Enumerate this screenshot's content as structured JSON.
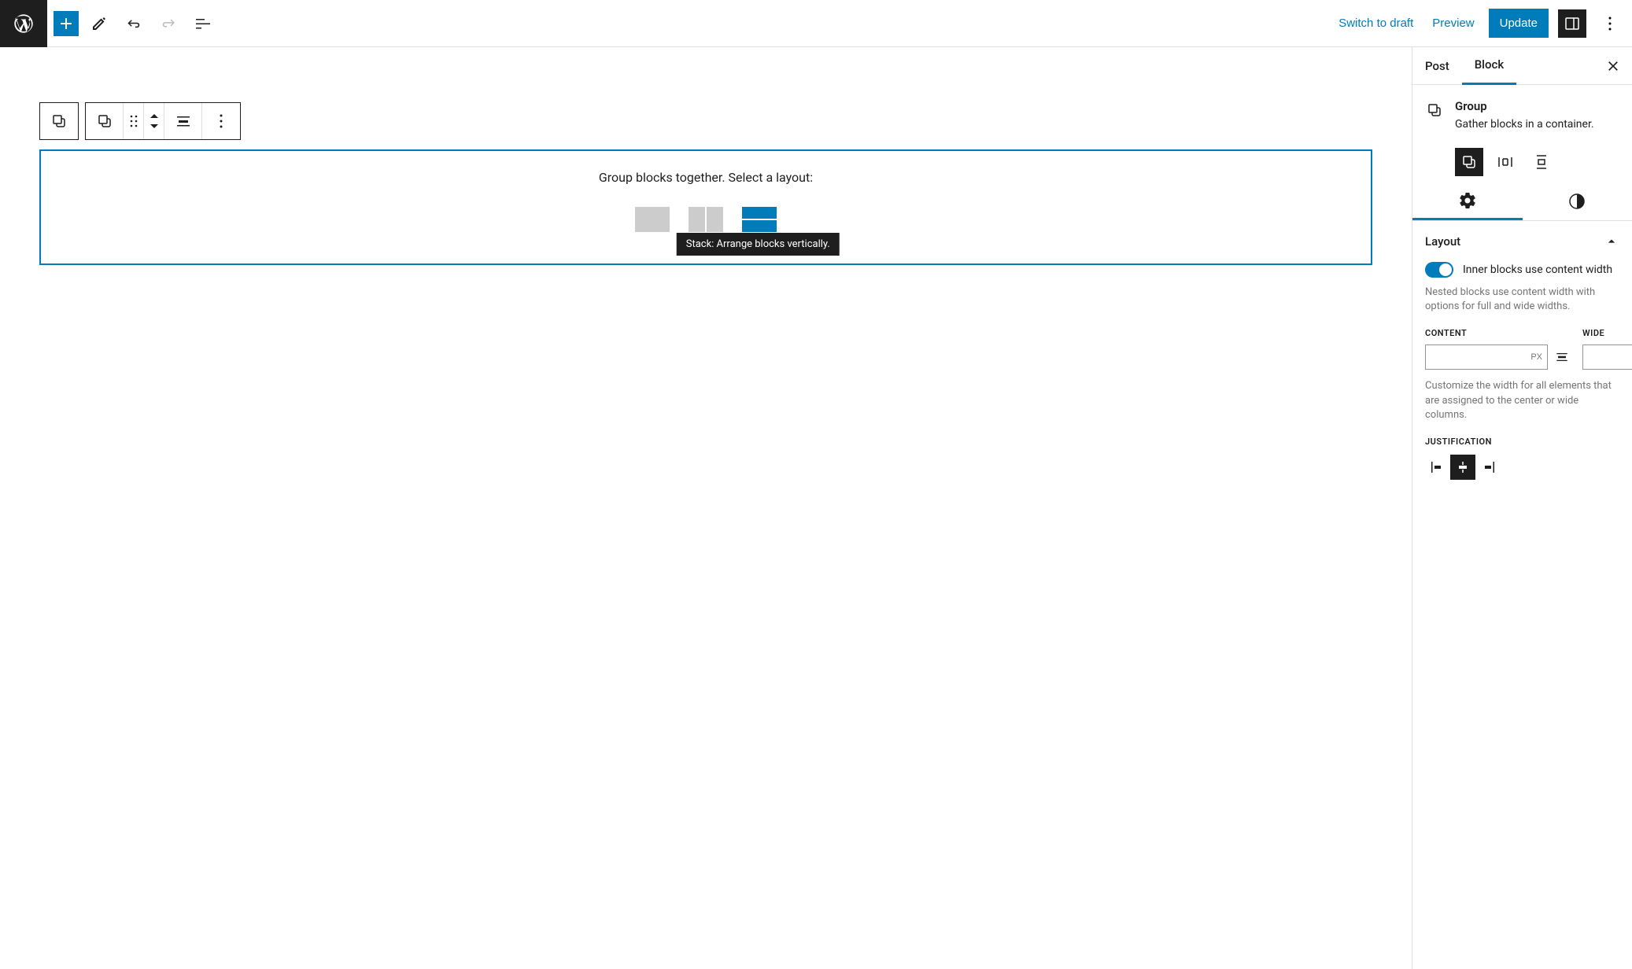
{
  "topbar": {
    "switch_draft": "Switch to draft",
    "preview": "Preview",
    "update": "Update"
  },
  "canvas": {
    "group_prompt": "Group blocks together. Select a layout:",
    "tooltip": "Stack: Arrange blocks vertically."
  },
  "sidebar": {
    "tabs": {
      "post": "Post",
      "block": "Block"
    },
    "block": {
      "title": "Group",
      "description": "Gather blocks in a container."
    },
    "layout": {
      "title": "Layout",
      "toggle_label": "Inner blocks use content width",
      "toggle_help": "Nested blocks use content width with options for full and wide widths.",
      "content_label": "CONTENT",
      "wide_label": "WIDE",
      "unit": "PX",
      "width_help": "Customize the width for all elements that are assigned to the center or wide columns.",
      "justification_label": "JUSTIFICATION"
    }
  }
}
